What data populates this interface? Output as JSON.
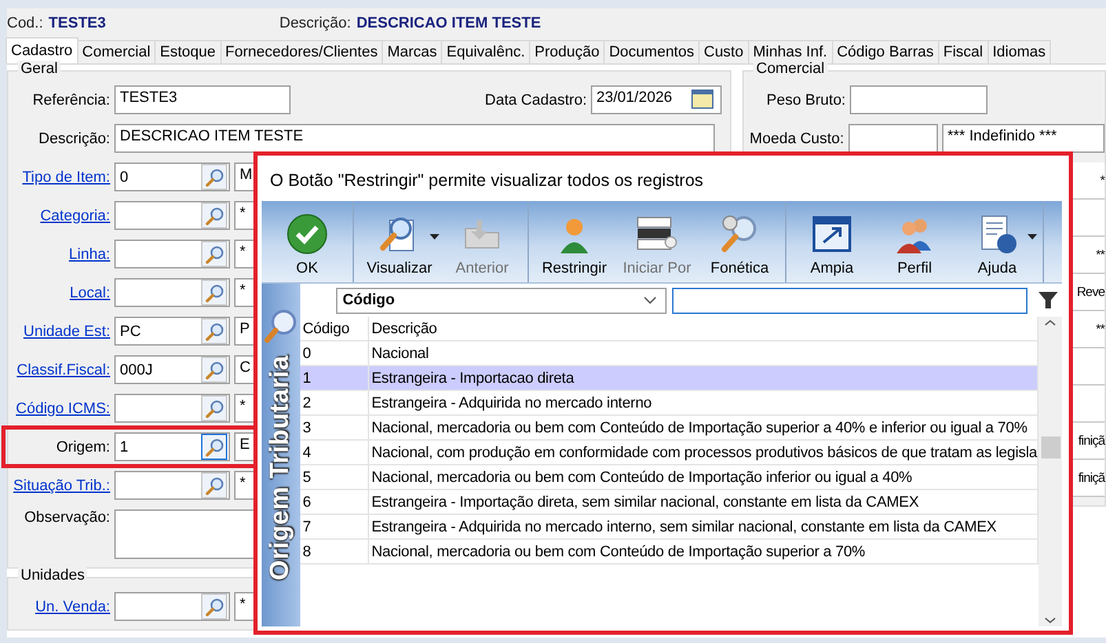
{
  "header": {
    "code_label": "Cod.:",
    "code": "TESTE3",
    "desc_label": "Descrição:",
    "desc": "DESCRICAO ITEM TESTE"
  },
  "tabs": [
    {
      "label": "Cadastro",
      "selected": true
    },
    {
      "label": "Comercial",
      "selected": false
    },
    {
      "label": "Estoque",
      "selected": false
    },
    {
      "label": "Fornecedores/Clientes",
      "selected": false
    },
    {
      "label": "Marcas",
      "selected": false
    },
    {
      "label": "Equivalênc.",
      "selected": false
    },
    {
      "label": "Produção",
      "selected": false
    },
    {
      "label": "Documentos",
      "selected": false
    },
    {
      "label": "Custo",
      "selected": false
    },
    {
      "label": "Minhas Inf.",
      "selected": false
    },
    {
      "label": "Código Barras",
      "selected": false
    },
    {
      "label": "Fiscal",
      "selected": false
    },
    {
      "label": "Idiomas",
      "selected": false
    }
  ],
  "geral": {
    "title": "Geral",
    "referencia": {
      "label": "Referência:",
      "value": "TESTE3"
    },
    "data_cadastro": {
      "label": "Data Cadastro:",
      "value": "23/01/2026"
    },
    "descricao": {
      "label": "Descrição:",
      "value": "DESCRICAO ITEM TESTE"
    },
    "lookups": [
      {
        "label": "Tipo de Item:",
        "link": true,
        "value": "0",
        "desc": "M",
        "highlighted": false
      },
      {
        "label": "Categoria:",
        "link": true,
        "desc": "*",
        "highlighted": false
      },
      {
        "label": "Linha:",
        "link": true,
        "desc": "*",
        "highlighted": false
      },
      {
        "label": "Local:",
        "link": true,
        "desc": "*",
        "highlighted": false
      },
      {
        "label": "Unidade Est:",
        "link": true,
        "value": "PC",
        "desc": "P",
        "highlighted": false
      },
      {
        "label": "Classif.Fiscal:",
        "link": true,
        "value": "000J",
        "desc": "C",
        "highlighted": false
      },
      {
        "label": "Código ICMS:",
        "link": true,
        "desc": "*",
        "highlighted": false
      },
      {
        "label": "Origem:",
        "link": false,
        "value": "1",
        "desc": "E",
        "highlighted": true
      },
      {
        "label": "Situação Trib.:",
        "link": true,
        "desc": "*",
        "highlighted": false
      }
    ],
    "observacao": {
      "label": "Observação:"
    }
  },
  "unidades": {
    "title": "Unidades",
    "lookups": [
      {
        "label": "Un. Venda:",
        "link": true,
        "desc": "*",
        "highlighted": false
      }
    ]
  },
  "comercial": {
    "title": "Comercial",
    "peso_bruto": {
      "label": "Peso Bruto:"
    },
    "moeda_custo": {
      "label": "Moeda Custo:",
      "desc": "*** Indefinido ***"
    },
    "edge_rows": [
      {
        "kind": "text",
        "text": "*"
      },
      {
        "kind": "blank"
      },
      {
        "kind": "text",
        "text": "**"
      },
      {
        "kind": "text",
        "text": "Reve"
      },
      {
        "kind": "text",
        "text": "**"
      },
      {
        "kind": "blank"
      },
      {
        "kind": "blank"
      },
      {
        "kind": "text",
        "text": "finiçã"
      },
      {
        "kind": "text",
        "text": "finiçã"
      }
    ]
  },
  "dialog": {
    "title": "O Botão \"Restringir\" permite visualizar todos os registros",
    "toolbar": [
      [
        {
          "label": "OK",
          "disabled": false,
          "dropdown": false
        }
      ],
      [
        {
          "label": "Visualizar",
          "disabled": false,
          "dropdown": true
        },
        {
          "label": "Anterior",
          "disabled": true,
          "dropdown": false
        }
      ],
      [
        {
          "label": "Restringir",
          "disabled": false,
          "dropdown": false
        },
        {
          "label": "Iniciar Por",
          "disabled": true,
          "dropdown": false
        },
        {
          "label": "Fonética",
          "disabled": false,
          "dropdown": false
        }
      ],
      [
        {
          "label": "Ampia",
          "disabled": false,
          "dropdown": false
        },
        {
          "label": "Perfil",
          "disabled": false,
          "dropdown": false
        },
        {
          "label": "Ajuda",
          "disabled": false,
          "dropdown": true
        }
      ]
    ],
    "side_title": "Origem Tributaria",
    "filter": {
      "field": "Código"
    },
    "columns": [
      "Código",
      "Descrição"
    ],
    "rows": [
      {
        "code": "0",
        "desc": "Nacional",
        "selected": false
      },
      {
        "code": "1",
        "desc": "Estrangeira - Importacao direta",
        "selected": true
      },
      {
        "code": "2",
        "desc": "Estrangeira - Adquirida no mercado interno",
        "selected": false
      },
      {
        "code": "3",
        "desc": "Nacional, mercadoria ou bem com Conteúdo de Importação superior a 40% e inferior ou igual a 70%",
        "selected": false
      },
      {
        "code": "4",
        "desc": "Nacional, com produção em conformidade com processos produtivos básicos de que tratam as legisla",
        "selected": false
      },
      {
        "code": "5",
        "desc": "Nacional, mercadoria ou bem com Conteúdo de Importação inferior ou igual a 40%",
        "selected": false
      },
      {
        "code": "6",
        "desc": "Estrangeira - Importação direta, sem similar nacional, constante em lista da CAMEX",
        "selected": false
      },
      {
        "code": "7",
        "desc": "Estrangeira - Adquirida no mercado interno, sem similar nacional, constante em lista da CAMEX",
        "selected": false
      },
      {
        "code": "8",
        "desc": "Nacional, mercadoria ou bem com Conteúdo de Importação superior a 70%",
        "selected": false
      }
    ]
  }
}
